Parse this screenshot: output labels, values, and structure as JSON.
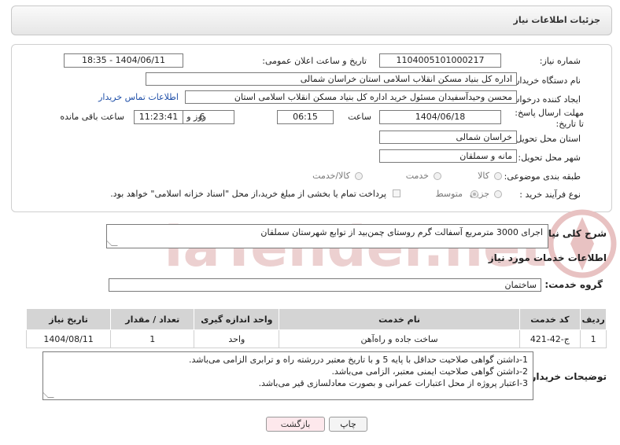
{
  "header": {
    "title": "جزئیات اطلاعات نیاز"
  },
  "form": {
    "need_number_label": "شماره نیاز:",
    "need_number": "1104005101000217",
    "announce_label": "تاریخ و ساعت اعلان عمومی:",
    "announce_value": "1404/06/11 - 18:35",
    "buyer_org_label": "نام دستگاه خریدار:",
    "buyer_org": "اداره کل بنیاد مسکن انقلاب اسلامی استان خراسان شمالی",
    "creator_label": "ایجاد کننده درخواست:",
    "creator": "محسن وحیدآسفیدان مسئول خرید اداره کل بنیاد مسکن انقلاب اسلامی استان",
    "contact_link": "اطلاعات تماس خریدار",
    "deadline_label": "مهلت ارسال پاسخ: تا تاریخ:",
    "deadline_date": "1404/06/18",
    "time_label": "ساعت",
    "deadline_time": "06:15",
    "days": "6",
    "days_label": "روز و",
    "remaining_time": "11:23:41",
    "remaining_label": "ساعت باقی مانده",
    "province_label": "استان محل تحویل:",
    "province": "خراسان شمالی",
    "city_label": "شهر محل تحویل:",
    "city": "مانه و سملقان",
    "category_label": "طبقه بندی موضوعی:",
    "category_options": [
      "کالا",
      "خدمت",
      "کالا/خدمت"
    ],
    "process_label": "نوع فرآیند خرید :",
    "process_options": [
      "جزیی",
      "متوسط"
    ],
    "payment_text": "پرداخت تمام یا بخشی از مبلغ خرید،از محل \"اسناد خزانه اسلامی\" خواهد بود."
  },
  "summary": {
    "label": "شرح کلی نیاز:",
    "text": "اجرای 3000 مترمربع آسفالت گرم روستای چمن‌بید از توابع شهرستان سملقان"
  },
  "services": {
    "section_title": "اطلاعات خدمات مورد نیاز",
    "group_label": "گروه خدمت:",
    "group_value": "ساختمان",
    "columns": [
      "ردیف",
      "کد خدمت",
      "نام خدمت",
      "واحد اندازه گیری",
      "تعداد / مقدار",
      "تاریخ نیاز"
    ],
    "rows": [
      [
        "1",
        "ج-42-421",
        "ساخت جاده و راه‌آهن",
        "واحد",
        "1",
        "1404/08/11"
      ]
    ]
  },
  "buyer_notes": {
    "label": "توضیحات خریدار:",
    "lines": [
      "1-داشتن گواهی صلاحیت حداقل با پایه 5 و با تاریخ معتبر دررشته راه و ترابری الزامی می‌باشد.",
      "2-داشتن گواهی صلاحیت ایمنی معتبر، الزامی می‌باشد.",
      "3-اعتبار پروژه از محل اعتبارات عمرانی و بصورت معادلسازی قیر می‌باشد."
    ]
  },
  "buttons": {
    "print": "چاپ",
    "back": "بازگشت"
  },
  "watermark": {
    "text": "AriaTender.net"
  },
  "colors": {
    "link": "#1f4fa8",
    "back_button": "#fde8ec",
    "table_header": "#d4d4d4",
    "watermark": "#e3b9b9"
  }
}
